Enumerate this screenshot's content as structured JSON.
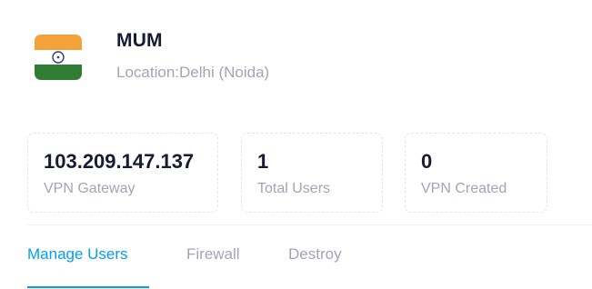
{
  "server": {
    "flag_icon": "india-flag-icon",
    "name": "MUM",
    "location": "Location:Delhi (Noida)"
  },
  "stats": {
    "gateway": {
      "value": "103.209.147.137",
      "label": "VPN Gateway"
    },
    "users": {
      "value": "1",
      "label": "Total Users"
    },
    "created": {
      "value": "0",
      "label": "VPN Created"
    }
  },
  "tabs": [
    {
      "label": "Manage Users",
      "active": true
    },
    {
      "label": "Firewall",
      "active": false
    },
    {
      "label": "Destroy",
      "active": false
    }
  ],
  "colors": {
    "accent": "#009ef7",
    "saffron": "#ff9933",
    "green": "#138808",
    "chakra": "#000080"
  }
}
